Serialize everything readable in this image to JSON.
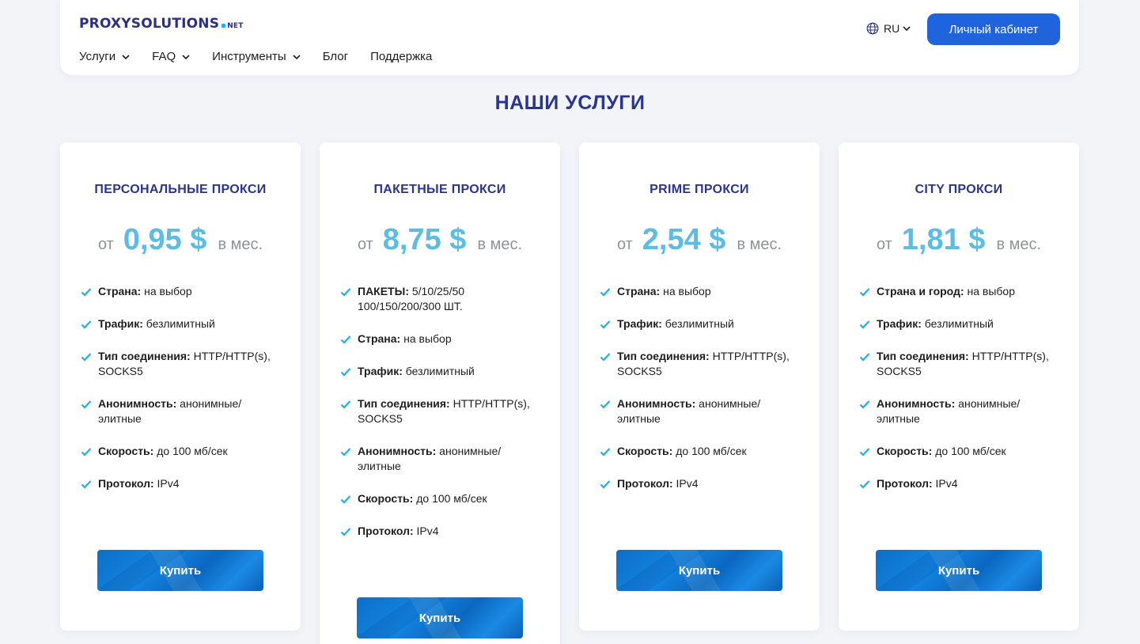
{
  "header": {
    "logo_main": "PROXYSOLUTIONS",
    "logo_suffix": "NET",
    "nav": [
      {
        "label": "Услуги",
        "has_dropdown": true
      },
      {
        "label": "FAQ",
        "has_dropdown": true
      },
      {
        "label": "Инструменты",
        "has_dropdown": true
      },
      {
        "label": "Блог",
        "has_dropdown": false
      },
      {
        "label": "Поддержка",
        "has_dropdown": false
      }
    ],
    "language": "RU",
    "cabinet_label": "Личный кабинет"
  },
  "section_title": "НАШИ УСЛУГИ",
  "colors": {
    "accent_blue": "#1f63dd",
    "title_navy": "#2a3591",
    "price_cyan": "#5bbde3",
    "check_cyan": "#1bb0e6"
  },
  "cards": [
    {
      "title": "ПЕРСОНАЛЬНЫЕ ПРОКСИ",
      "price_prefix": "от",
      "price": "0,95 $",
      "price_suffix": "в мес.",
      "features": [
        {
          "label": "Страна:",
          "value": "на выбор"
        },
        {
          "label": "Трафик:",
          "value": "безлимитный"
        },
        {
          "label": "Тип соединения:",
          "value": "HTTP/HTTP(s), SOCKS5"
        },
        {
          "label": "Анонимность:",
          "value": "анонимные/ элитные"
        },
        {
          "label": "Скорость:",
          "value": "до 100 мб/сек"
        },
        {
          "label": "Протокол:",
          "value": "IPv4"
        }
      ],
      "buy_label": "Купить"
    },
    {
      "title": "ПАКЕТНЫЕ ПРОКСИ",
      "price_prefix": "от",
      "price": "8,75 $",
      "price_suffix": "в мес.",
      "features": [
        {
          "label": "ПАКЕТЫ:",
          "value": "5/10/25/50 100/150/200/300 ШТ."
        },
        {
          "label": "Страна:",
          "value": "на выбор"
        },
        {
          "label": "Трафик:",
          "value": "безлимитный"
        },
        {
          "label": "Тип соединения:",
          "value": "HTTP/HTTP(s), SOCKS5"
        },
        {
          "label": "Анонимность:",
          "value": "анонимные/ элитные"
        },
        {
          "label": "Скорость:",
          "value": "до 100 мб/сек"
        },
        {
          "label": "Протокол:",
          "value": "IPv4"
        }
      ],
      "buy_label": "Купить"
    },
    {
      "title": "PRIME ПРОКСИ",
      "price_prefix": "от",
      "price": "2,54 $",
      "price_suffix": "в мес.",
      "features": [
        {
          "label": "Страна:",
          "value": "на выбор"
        },
        {
          "label": "Трафик:",
          "value": "безлимитный"
        },
        {
          "label": "Тип соединения:",
          "value": "HTTP/HTTP(s), SOCKS5"
        },
        {
          "label": "Анонимность:",
          "value": "анонимные/ элитные"
        },
        {
          "label": "Скорость:",
          "value": "до 100 мб/сек"
        },
        {
          "label": "Протокол:",
          "value": "IPv4"
        }
      ],
      "buy_label": "Купить"
    },
    {
      "title": "CITY ПРОКСИ",
      "price_prefix": "от",
      "price": "1,81 $",
      "price_suffix": "в мес.",
      "features": [
        {
          "label": "Страна и город:",
          "value": "на выбор"
        },
        {
          "label": "Трафик:",
          "value": "безлимитный"
        },
        {
          "label": "Тип соединения:",
          "value": "HTTP/HTTP(s), SOCKS5"
        },
        {
          "label": "Анонимность:",
          "value": "анонимные/ элитные"
        },
        {
          "label": "Скорость:",
          "value": "до 100 мб/сек"
        },
        {
          "label": "Протокол:",
          "value": "IPv4"
        }
      ],
      "buy_label": "Купить"
    }
  ]
}
